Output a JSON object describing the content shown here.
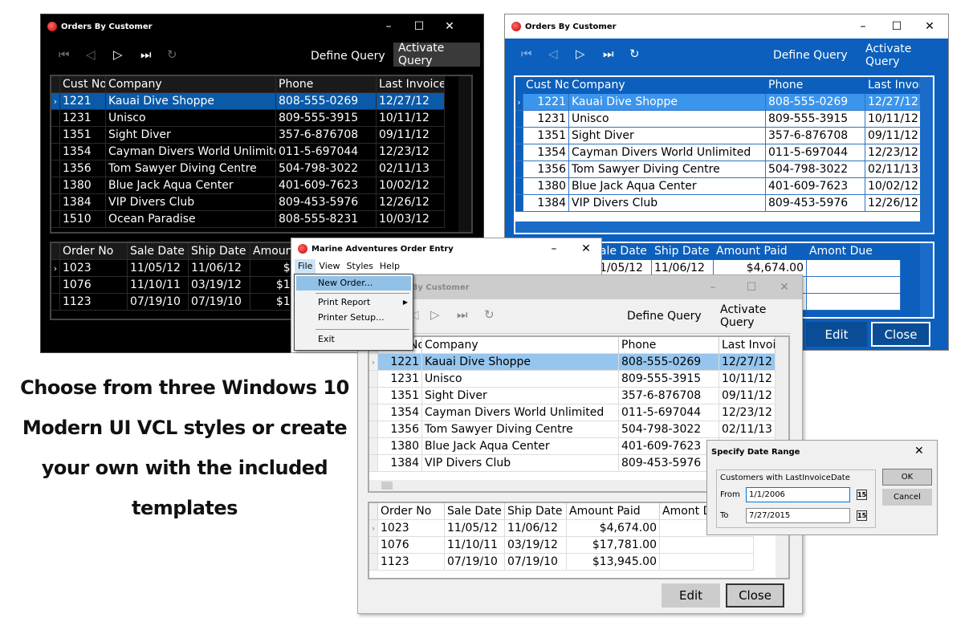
{
  "caption": [
    "Choose from three Windows 10",
    "Modern UI VCL styles or create",
    "your own with the included templates"
  ],
  "colors": {
    "dark_bg": "#000000",
    "dark_selection": "#0a5aa8",
    "blue_bg": "#0c5fbd",
    "blue_selection": "#3c95ec",
    "light_selection": "#96c6ee"
  },
  "icons": {
    "app": "red-globe-logo",
    "nav": [
      "first-icon",
      "prior-icon",
      "next-icon",
      "last-icon",
      "refresh-icon"
    ]
  },
  "orders_window": {
    "title": "Orders By Customer",
    "define_query": "Define Query",
    "activate_query": "Activate Query",
    "edit": "Edit",
    "close": "Close"
  },
  "customers": {
    "headers": [
      "Cust No",
      "Company",
      "Phone",
      "Last Invoice"
    ],
    "rows": [
      [
        "1221",
        "Kauai Dive Shoppe",
        "808-555-0269",
        "12/27/12"
      ],
      [
        "1231",
        "Unisco",
        "809-555-3915",
        "10/11/12"
      ],
      [
        "1351",
        "Sight Diver",
        "357-6-876708",
        "09/11/12"
      ],
      [
        "1354",
        "Cayman Divers World Unlimited",
        "011-5-697044",
        "12/23/12"
      ],
      [
        "1356",
        "Tom Sawyer Diving Centre",
        "504-798-3022",
        "02/11/13"
      ],
      [
        "1380",
        "Blue Jack Aqua Center",
        "401-609-7623",
        "10/02/12"
      ],
      [
        "1384",
        "VIP Divers Club",
        "809-453-5976",
        "12/26/12"
      ],
      [
        "1510",
        "Ocean Paradise",
        "808-555-8231",
        "10/03/12"
      ]
    ],
    "last_invoice_truncated": [
      "12/27/12 1",
      "10/11/12 2",
      "09/11/12 7",
      "12/23/12 2",
      "02/11/13 9",
      "10/02/12 1",
      "12/26/12 6"
    ],
    "header_truncated": "Last Invoic"
  },
  "orders": {
    "headers": [
      "Order No",
      "Sale Date",
      "Ship Date",
      "Amount Paid",
      "Amont Due"
    ],
    "rows": [
      [
        "1023",
        "11/05/12",
        "11/06/12",
        "$4,674.00",
        ""
      ],
      [
        "1076",
        "11/10/11",
        "03/19/12",
        "$17,781.00",
        ""
      ],
      [
        "1123",
        "07/19/10",
        "07/19/10",
        "$13,945.00",
        ""
      ]
    ]
  },
  "order_entry": {
    "title": "Marine Adventures Order Entry",
    "menus": [
      "File",
      "View",
      "Styles",
      "Help"
    ],
    "file_menu": [
      "New Order...",
      "Print Report",
      "Printer Setup...",
      "Exit"
    ]
  },
  "date_dialog": {
    "title": "Specify Date Range",
    "group": "Customers with LastInvoiceDate",
    "from_label": "From",
    "from_value": "1/1/2006",
    "to_label": "To",
    "to_value": "7/27/2015",
    "calendar_glyph": "15",
    "ok": "OK",
    "cancel": "Cancel"
  }
}
